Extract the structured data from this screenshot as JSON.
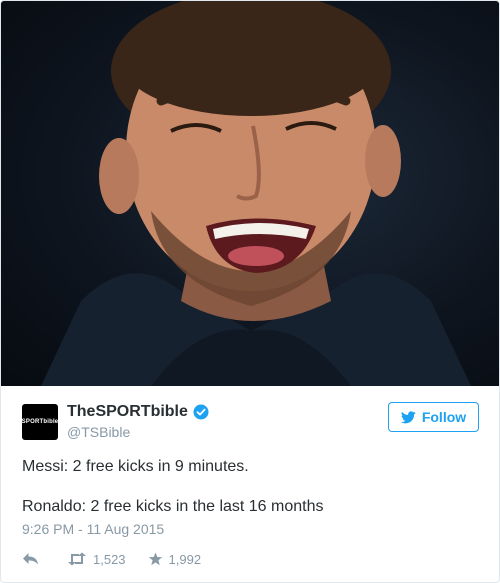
{
  "photo": {
    "alt": ""
  },
  "author": {
    "name": "TheSPORTbible",
    "handle": "@TSBible",
    "avatar_text": "SPORTbible"
  },
  "follow_label": "Follow",
  "tweet": {
    "line1": "Messi: 2 free kicks in 9 minutes.",
    "line2": "Ronaldo: 2 free kicks in the last 16 months",
    "timestamp": "9:26 PM - 11 Aug 2015"
  },
  "stats": {
    "retweets": "1,523",
    "likes": "1,992"
  },
  "colors": {
    "accent": "#1da1f2",
    "text": "#292f33",
    "muted": "#8899a6"
  },
  "icons": [
    "reply-icon",
    "retweet-icon",
    "like-icon",
    "verified-icon",
    "twitter-bird-icon"
  ]
}
